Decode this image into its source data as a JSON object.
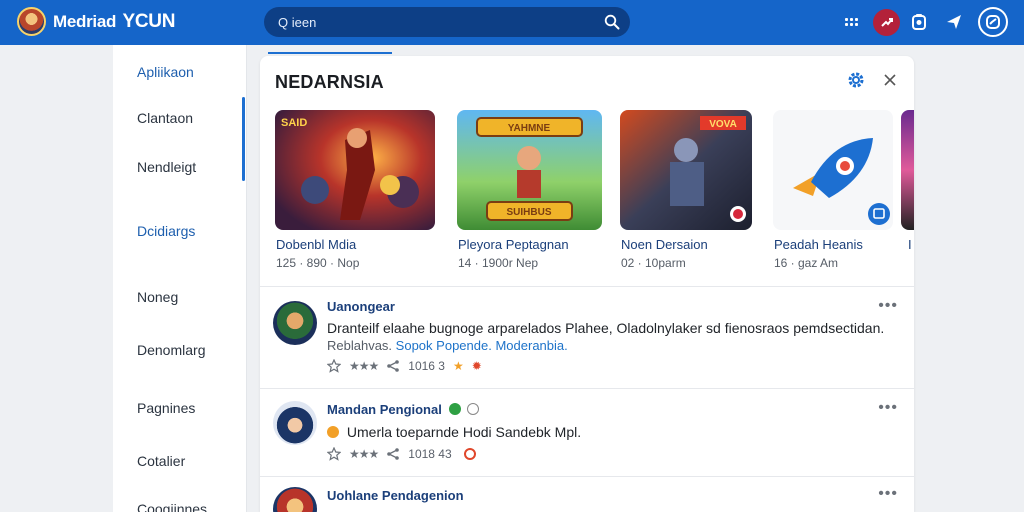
{
  "header": {
    "brand_1": "Medriad",
    "brand_2": "YCUN",
    "search_value": "Q ieen",
    "icons": [
      "grid-icon",
      "trending-icon",
      "badge-icon",
      "send-icon",
      "profile-icon"
    ],
    "accent_color": "#1565c9"
  },
  "sidebar": {
    "items": [
      {
        "label": "Apliikaon"
      },
      {
        "label": "Clantaon"
      },
      {
        "label": "Nendleigt"
      },
      {
        "label": "Dcidiargs"
      },
      {
        "label": "Noneg"
      },
      {
        "label": "Denomlarg"
      },
      {
        "label": "Pagnines"
      },
      {
        "label": "Cotalier"
      },
      {
        "label": "Coogiinnes"
      }
    ]
  },
  "panel": {
    "title": "NEDARNSIA",
    "cards": [
      {
        "title": "Dobenbl Mdia",
        "sub": "125 · 890 · Nop"
      },
      {
        "title": "Pleyora Peptagnan",
        "sub": "14 · 1900r Nep"
      },
      {
        "title": "Noen Dersaion",
        "sub": "02 · 10parm"
      },
      {
        "title": "Peadah Heanis",
        "sub": "16 · gaz Am"
      },
      {
        "title": "I",
        "sub": ""
      }
    ],
    "thumb_labels": {
      "card1": "SAID",
      "card2_top": "YAHMNE",
      "card2_bottom": "SUIHBUS",
      "card3": "VOVA"
    },
    "posts": [
      {
        "name": "Uanongear",
        "text": "Dranteilf elaahe bugnoge arparelados Plahee, Oladolnylaker sd fienosraos pemdsectidan.",
        "tags_prefix": "Reblahvas.",
        "tag_1": "Sopok",
        "tag_2": "Popende.",
        "tag_3": "Moderanbia.",
        "stat": "1016 3",
        "more": "•••"
      },
      {
        "name": "Mandan Pengional",
        "text": "Umerla toeparnde Hodi Sandebk Mpl.",
        "stat": "1018 43",
        "more": "•••"
      },
      {
        "name": "Uohlane Pendagenion",
        "more": "•••"
      }
    ]
  }
}
